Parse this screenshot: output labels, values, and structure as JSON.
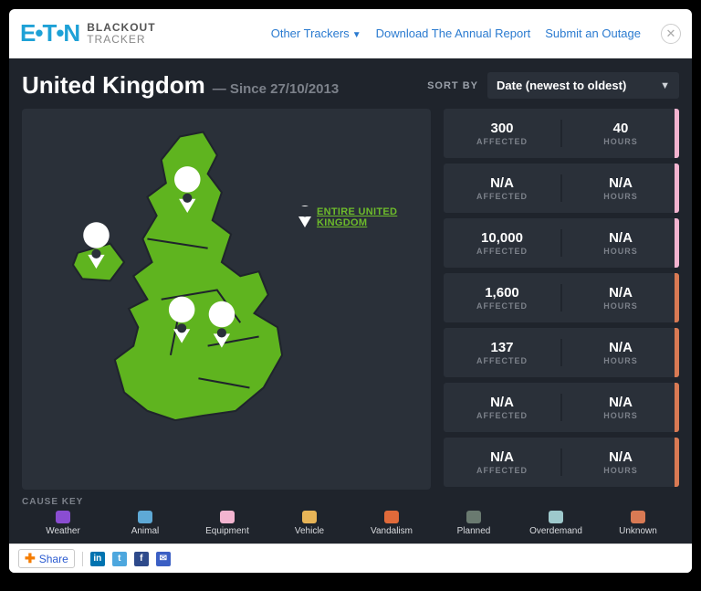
{
  "brand": {
    "mark": "E•T•N",
    "line1": "BLACKOUT",
    "line2": "TRACKER"
  },
  "nav": {
    "other_trackers": "Other Trackers",
    "download": "Download The Annual Report",
    "submit": "Submit an Outage"
  },
  "page": {
    "title": "United Kingdom",
    "since": "— Since 27/10/2013",
    "sort_label": "SORT BY",
    "sort_value": "Date (newest to oldest)"
  },
  "map": {
    "link_label": "ENTIRE UNITED KINGDOM"
  },
  "columns": {
    "affected": "AFFECTED",
    "hours": "HOURS"
  },
  "outages": [
    {
      "affected": "300",
      "hours": "40",
      "cause_color": "#f3b4d0"
    },
    {
      "affected": "N/A",
      "hours": "N/A",
      "cause_color": "#f3b4d0"
    },
    {
      "affected": "10,000",
      "hours": "N/A",
      "cause_color": "#f3b4d0"
    },
    {
      "affected": "1,600",
      "hours": "N/A",
      "cause_color": "#d97a54"
    },
    {
      "affected": "137",
      "hours": "N/A",
      "cause_color": "#d97a54"
    },
    {
      "affected": "N/A",
      "hours": "N/A",
      "cause_color": "#d97a54"
    },
    {
      "affected": "N/A",
      "hours": "N/A",
      "cause_color": "#d97a54"
    }
  ],
  "legend": {
    "title": "CAUSE KEY",
    "items": [
      {
        "label": "Weather",
        "color": "#8a4dd1"
      },
      {
        "label": "Animal",
        "color": "#5ea9d6"
      },
      {
        "label": "Equipment",
        "color": "#f3b4d0"
      },
      {
        "label": "Vehicle",
        "color": "#e7b457"
      },
      {
        "label": "Vandalism",
        "color": "#e06a3a"
      },
      {
        "label": "Planned",
        "color": "#6a7a70"
      },
      {
        "label": "Overdemand",
        "color": "#9ec9cc"
      },
      {
        "label": "Unknown",
        "color": "#d97a54"
      }
    ]
  },
  "share": {
    "label": "Share"
  }
}
